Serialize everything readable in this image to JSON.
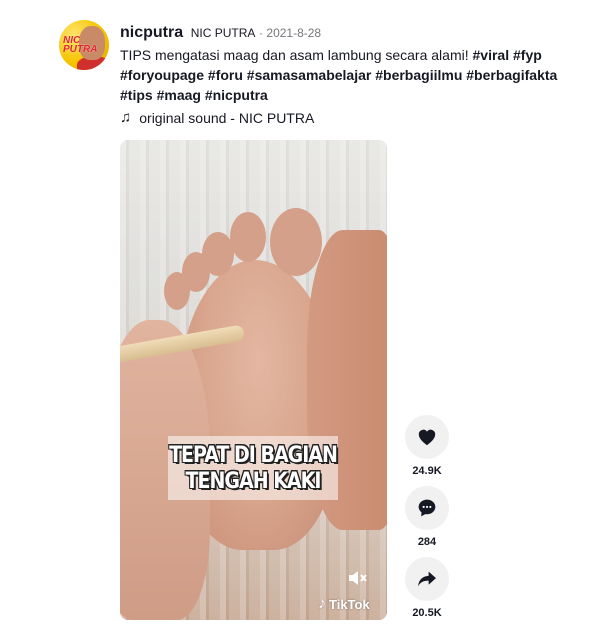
{
  "post": {
    "username": "nicputra",
    "nickname": "NIC PUTRA",
    "date": "2021-8-28",
    "caption_text": "TIPS mengatasi maag dan asam lambung secara alami!",
    "hashtags": [
      "#viral",
      "#fyp",
      "#foryoupage",
      "#foru",
      "#samasamabelajar",
      "#berbagiilmu",
      "#berbagifakta",
      "#tips",
      "#maag",
      "#nicputra"
    ],
    "music": "original sound - NIC PUTRA",
    "avatar_text": "NIC PUTRA"
  },
  "video": {
    "overlay_line1": "TEPAT DI BAGIAN",
    "overlay_line2": "TENGAH KAKI",
    "watermark": "TikTok",
    "mute_icon": "volume-mute-icon"
  },
  "actions": [
    {
      "name": "like",
      "icon": "heart-icon",
      "count": "24.9K"
    },
    {
      "name": "comment",
      "icon": "comment-icon",
      "count": "284"
    },
    {
      "name": "share",
      "icon": "share-icon",
      "count": "20.5K"
    }
  ],
  "colors": {
    "text": "#161823",
    "muted": "#75777c",
    "action_bg": "#f1f1f2"
  }
}
